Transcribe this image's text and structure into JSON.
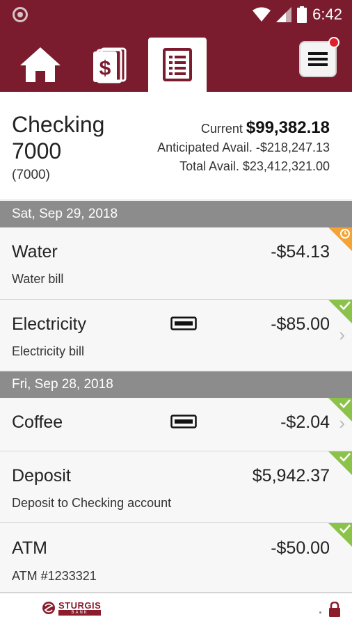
{
  "status_bar": {
    "time": "6:42"
  },
  "nav": {
    "tabs": [
      {
        "icon": "home-icon"
      },
      {
        "icon": "transfer-icon"
      },
      {
        "icon": "statement-icon",
        "active": true
      }
    ],
    "menu_icon": "hamburger-menu-icon"
  },
  "account": {
    "name": "Checking 7000",
    "number": "(7000)",
    "current_label": "Current",
    "current_amount": "$99,382.18",
    "anticipated_label": "Anticipated Avail.",
    "anticipated_amount": "-$218,247.13",
    "total_label": "Total Avail.",
    "total_amount": "$23,412,321.00"
  },
  "groups": [
    {
      "date": "Sat, Sep 29, 2018",
      "transactions": [
        {
          "name": "Water",
          "desc": "Water bill",
          "amount": "-$54.13",
          "status": "pending"
        },
        {
          "name": "Electricity",
          "desc": "Electricity bill",
          "amount": "-$85.00",
          "status": "cleared"
        }
      ]
    },
    {
      "date": "Fri, Sep 28, 2018",
      "transactions": [
        {
          "name": "Coffee",
          "desc": "",
          "amount": "-$2.04",
          "status": "cleared"
        },
        {
          "name": "Deposit",
          "desc": "Deposit to Checking account",
          "amount": "$5,942.37",
          "status": "cleared"
        },
        {
          "name": "ATM",
          "desc": "ATM #1233321",
          "amount": "-$50.00",
          "status": "cleared"
        }
      ]
    }
  ],
  "footer": {
    "logo_text": "STURGIS",
    "logo_sub": "BANK"
  },
  "colors": {
    "brand": "#7b1c2e",
    "cleared": "#8bc34a",
    "pending": "#f4a436",
    "date_header": "#8c8c8c"
  }
}
